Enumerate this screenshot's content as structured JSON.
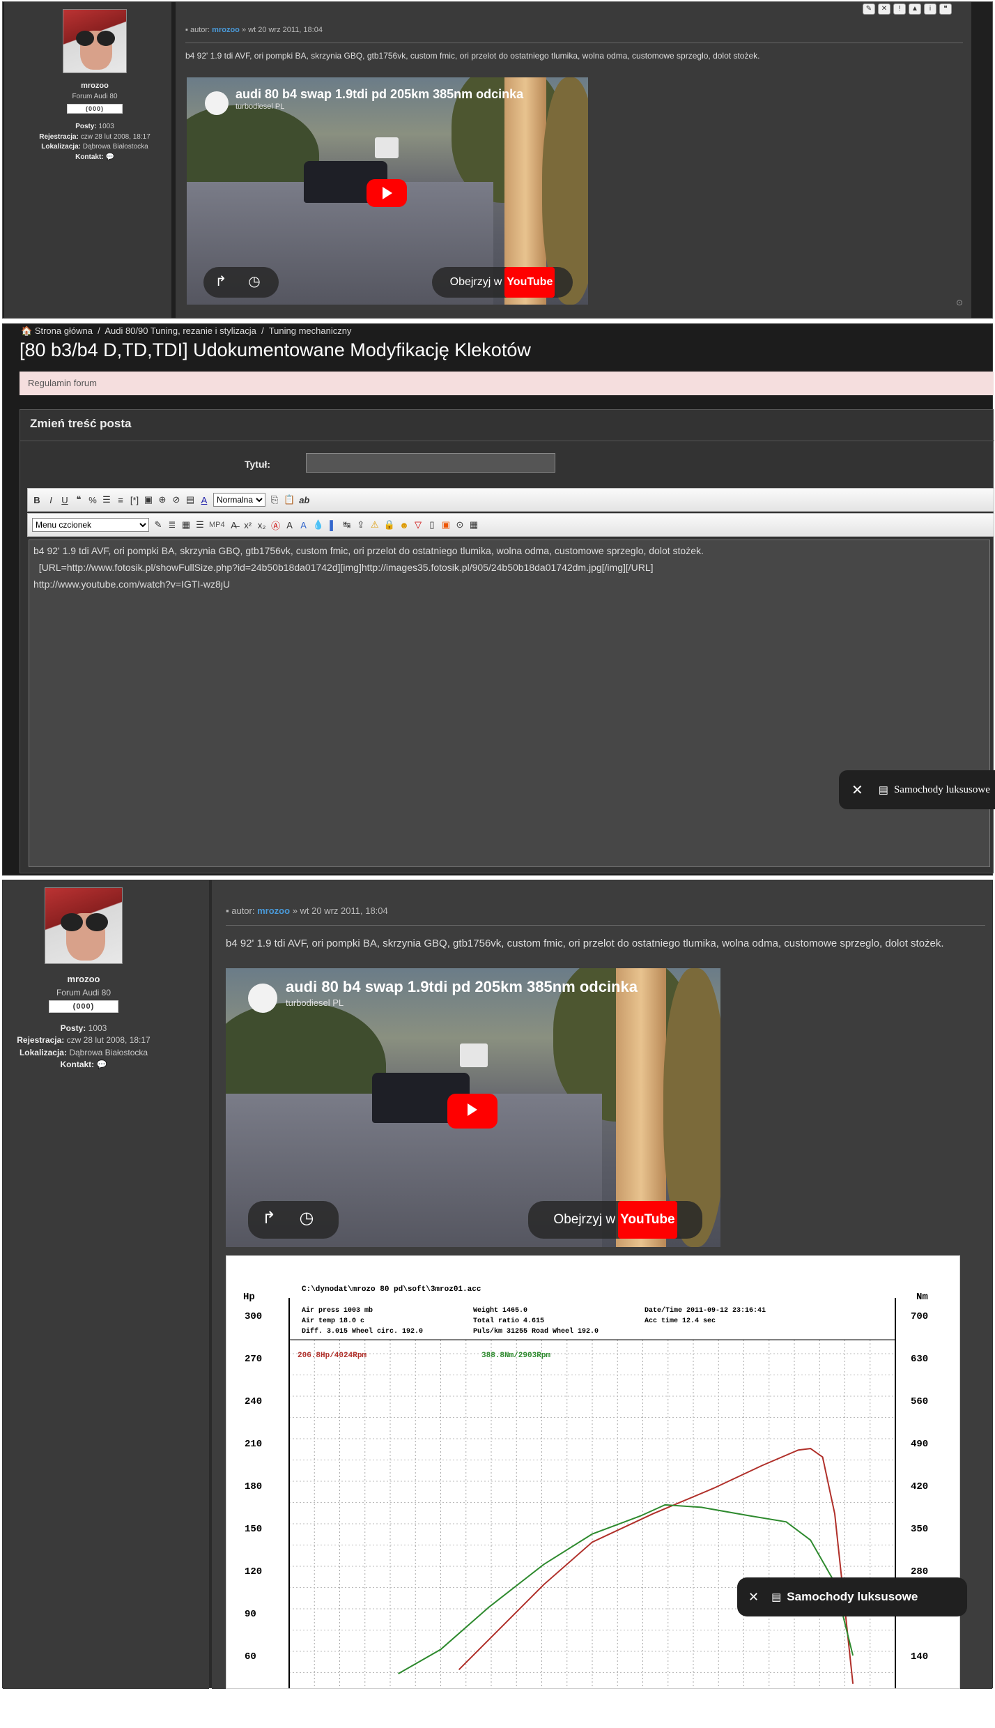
{
  "top_post": {
    "username": "mrozoo",
    "rank": "Forum Audi 80",
    "rank_badge": "(000)",
    "posts_label": "Posty:",
    "posts_value": "1003",
    "reg_label": "Rejestracja:",
    "reg_value": "czw 28 lut 2008, 18:17",
    "loc_label": "Lokalizacja:",
    "loc_value": "Dąbrowa Białostocka",
    "contact_label": "Kontakt:",
    "meta_prefix": "autor:",
    "meta_author": "mrozoo",
    "meta_date": "» wt 20 wrz 2011, 18:04",
    "text": "b4 92' 1.9 tdi AVF, ori pompki BA, skrzynia GBQ, gtb1756vk, custom fmic, ori przelot do ostatniego tlumika, wolna odma, customowe sprzeglo, dolot stożek.",
    "video_title": "audi 80 b4 swap 1.9tdi pd 205km 385nm odcinka",
    "video_channel": "turbodiesel PL",
    "watch_label": "Obejrzyj w",
    "youtube_label": "YouTube"
  },
  "breadcrumb": {
    "home": "Strona główna",
    "sep": "/",
    "item1": "Audi 80/90 Tuning, rezanie i stylizacja",
    "item2": "Tuning mechaniczny"
  },
  "page_title": "[80 b3/b4 D,TD,TDI] Udokumentowane Modyfikację Klekotów",
  "rules_label": "Regulamin forum",
  "edit": {
    "heading": "Zmień treść posta",
    "title_label": "Tytuł:",
    "font_size_value": "Normalna",
    "font_menu_value": "Menu czcionek",
    "mp4_label": "MP4",
    "ab_label": "ab",
    "body_text": "b4 92' 1.9 tdi AVF, ori pompki BA, skrzynia GBQ, gtb1756vk, custom fmic, ori przelot do ostatniego tlumika, wolna odma, customowe sprzeglo, dolot stożek.\n  [URL=http://www.fotosik.pl/showFullSize.php?id=24b50b18da01742d][img]http://images35.fotosik.pl/905/24b50b18da01742dm.jpg[/img][/URL]\nhttp://www.youtube.com/watch?v=IGTI-wz8ȷU"
  },
  "toast": {
    "label": "Samochody luksusowe"
  },
  "chart_data": {
    "type": "line",
    "header_path": "C:\\dynodat\\mrozo 80 pd\\soft\\3mroz01.acc",
    "info": [
      "Air press   1003 mb",
      "Air temp    18.0 c",
      "Diff.       3.015   Wheel circ. 192.0",
      "Weight      1465.0",
      "Total ratio 4.615",
      "Puls/km     31255   Road Wheel 192.0",
      "Date/Time   2011-09-12 23:16:41",
      "Acc time    12.4 sec"
    ],
    "left_unit": "Hp",
    "right_unit": "Nm",
    "left_ticks": [
      300,
      270,
      240,
      210,
      180,
      150,
      120,
      90,
      60
    ],
    "right_ticks": [
      700,
      630,
      560,
      490,
      420,
      350,
      280,
      210,
      140
    ],
    "peak_hp_label": "206.8Hp/4024Rpm",
    "peak_nm_label": "388.8Nm/2903Rpm",
    "series": [
      {
        "name": "Hp",
        "color": "#b0302a",
        "points": [
          [
            0.28,
            50
          ],
          [
            0.35,
            80
          ],
          [
            0.42,
            110
          ],
          [
            0.5,
            140
          ],
          [
            0.6,
            160
          ],
          [
            0.7,
            178
          ],
          [
            0.78,
            194
          ],
          [
            0.84,
            205
          ],
          [
            0.86,
            206
          ],
          [
            0.88,
            200
          ],
          [
            0.9,
            160
          ],
          [
            0.92,
            80
          ],
          [
            0.93,
            40
          ]
        ]
      },
      {
        "name": "Nm",
        "color": "#2e8a2e",
        "points": [
          [
            0.18,
            110
          ],
          [
            0.25,
            150
          ],
          [
            0.33,
            220
          ],
          [
            0.42,
            290
          ],
          [
            0.5,
            340
          ],
          [
            0.58,
            370
          ],
          [
            0.62,
            388
          ],
          [
            0.68,
            384
          ],
          [
            0.76,
            370
          ],
          [
            0.82,
            360
          ],
          [
            0.86,
            330
          ],
          [
            0.9,
            260
          ],
          [
            0.93,
            140
          ]
        ]
      }
    ]
  }
}
